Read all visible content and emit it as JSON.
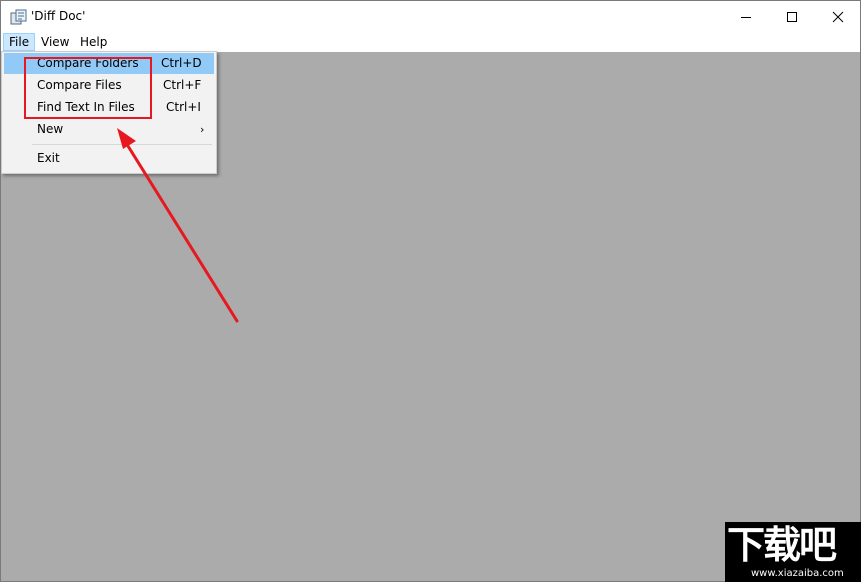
{
  "window": {
    "title": "'Diff Doc'",
    "controls": {
      "minimize_icon": "minimize-icon",
      "maximize_icon": "maximize-icon",
      "close_icon": "close-icon"
    }
  },
  "menubar": {
    "file": "File",
    "view": "View",
    "help": "Help"
  },
  "file_menu": {
    "items": [
      {
        "label": "Compare Folders",
        "shortcut": "Ctrl+D",
        "highlighted": true
      },
      {
        "label": "Compare Files",
        "shortcut": "Ctrl+F"
      },
      {
        "label": "Find Text In Files",
        "shortcut": "Ctrl+I"
      },
      {
        "label": "New",
        "submenu_arrow": "›"
      },
      {
        "label": "Exit"
      }
    ]
  },
  "annotation": {
    "color": "#e5191f"
  },
  "watermark": {
    "glyphs": "下载吧",
    "url": "www.xiazaiba.com"
  },
  "colors": {
    "client_bg": "#ababab",
    "menu_highlight": "#91c9f7",
    "menu_bg": "#f2f2f2"
  }
}
